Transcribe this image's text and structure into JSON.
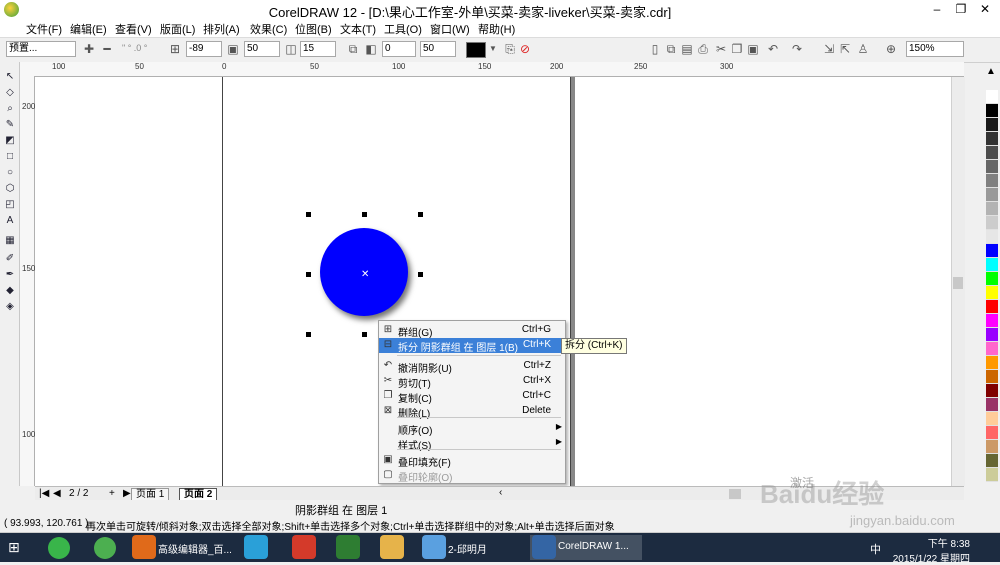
{
  "window": {
    "title": "CorelDRAW 12 - [D:\\果心工作室-外单\\买菜-卖家-liveker\\买菜-卖家.cdr]",
    "min": "–",
    "restore": "❐",
    "close": "✕"
  },
  "menu": [
    "文件(F)",
    "编辑(E)",
    "查看(V)",
    "版面(L)",
    "排列(A)",
    "效果(C)",
    "位图(B)",
    "文本(T)",
    "工具(O)",
    "窗口(W)",
    "帮助(H)"
  ],
  "propbar": {
    "preset": "预置...",
    "x_ratio": "\" ° .0 °",
    "angle": "-89",
    "offset_a": "50",
    "offset_b": "15",
    "opacity": "0",
    "feather": "50",
    "zoom": "150%"
  },
  "rulers": {
    "h": [
      "100",
      "50",
      "0",
      "50",
      "100",
      "150",
      "200",
      "250",
      "300"
    ],
    "v": [
      "200",
      "150",
      "100"
    ]
  },
  "context_menu": [
    {
      "icon": "group-icon",
      "label": "群组(G)",
      "shortcut": "Ctrl+G",
      "state": "normal"
    },
    {
      "icon": "break-apart-icon",
      "label": "拆分 阴影群组 在 图层 1(B)",
      "shortcut": "Ctrl+K",
      "state": "selected"
    },
    {
      "icon": "undo-shadow-icon",
      "label": "撤消阴影(U)",
      "shortcut": "Ctrl+Z",
      "state": "normal"
    },
    {
      "icon": "cut-icon",
      "label": "剪切(T)",
      "shortcut": "Ctrl+X",
      "state": "normal"
    },
    {
      "icon": "copy-icon",
      "label": "复制(C)",
      "shortcut": "Ctrl+C",
      "state": "normal"
    },
    {
      "icon": "delete-icon",
      "label": "删除(L)",
      "shortcut": "Delete",
      "state": "normal"
    },
    {
      "icon": "",
      "label": "顺序(O)",
      "shortcut": "",
      "state": "submenu"
    },
    {
      "icon": "",
      "label": "样式(S)",
      "shortcut": "",
      "state": "submenu"
    },
    {
      "icon": "overprint-fill-icon",
      "label": "叠印填充(F)",
      "shortcut": "",
      "state": "normal"
    },
    {
      "icon": "overprint-outline-icon",
      "label": "叠印轮廓(O)",
      "shortcut": "",
      "state": "disabled"
    }
  ],
  "tooltip": "拆分 (Ctrl+K)",
  "page_nav": {
    "count": "2 / 2",
    "tab1": "页面 1",
    "tab2": "页面 2"
  },
  "status": {
    "object": "阴影群组 在 图层 1",
    "coords": "( 93.993, 120.761 )",
    "hint": "再次单击可旋转/倾斜对象;双击选择全部对象;Shift+单击选择多个对象;Ctrl+单击选择群组中的对象;Alt+单击选择后面对象"
  },
  "watermark": {
    "logo": "Baidu经验",
    "url": "jingyan.baidu.com",
    "activate": "激活"
  },
  "palette": [
    "#ffffff",
    "#000000",
    "#1a1a1a",
    "#333333",
    "#4d4d4d",
    "#666666",
    "#808080",
    "#999999",
    "#b3b3b3",
    "#cccccc",
    "#e6e6e6",
    "#0000ff",
    "#00ffff",
    "#00ff00",
    "#ffff00",
    "#ff0000",
    "#ff00ff",
    "#9900ff",
    "#ff66cc",
    "#ff9900",
    "#cc6600",
    "#800000",
    "#993366",
    "#ffcc99",
    "#ff6666",
    "#cc9966",
    "#666633",
    "#cccc99"
  ],
  "taskbar": {
    "tasks": [
      {
        "label": "高级编辑器_百...",
        "color": "#e06a1a"
      },
      {
        "label": "",
        "color": "#2aa0d8"
      },
      {
        "label": "",
        "color": "#d43a2a"
      },
      {
        "label": "",
        "color": "#2e7d32"
      },
      {
        "label": "",
        "color": "#e6b34a"
      },
      {
        "label": "2-邱明月",
        "color": "#5aa0e0"
      },
      {
        "label": "CorelDRAW 1...",
        "color": "#3465a4"
      }
    ],
    "time": "下午 8:38",
    "date": "2015/1/22 星期四",
    "ime": "中"
  }
}
